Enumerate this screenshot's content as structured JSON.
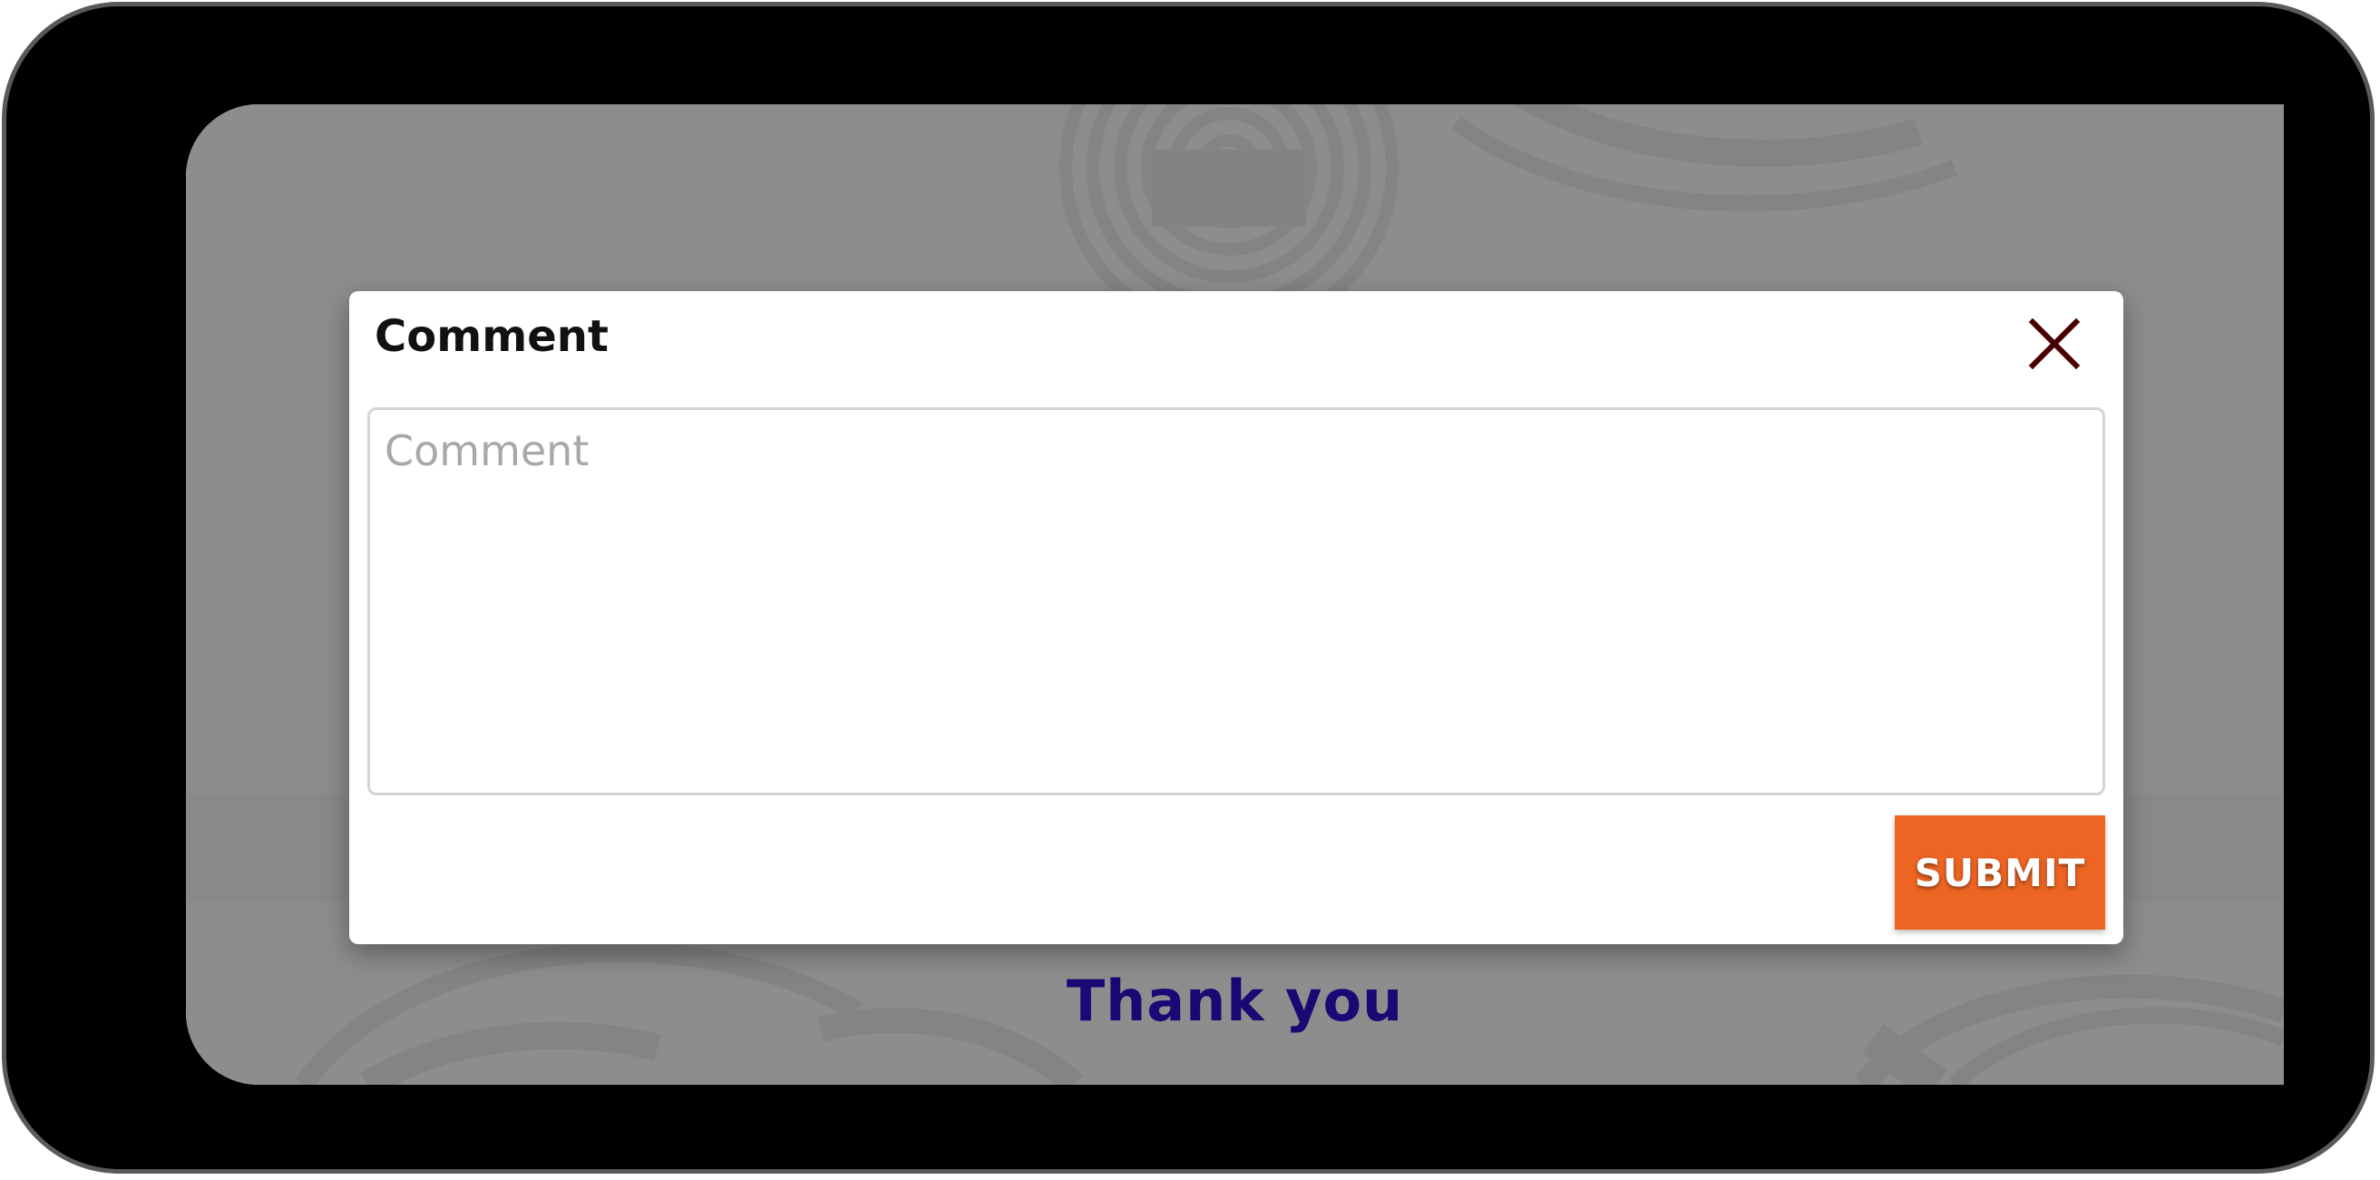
{
  "modal": {
    "title": "Comment",
    "close_icon": "close-icon",
    "comment_input": {
      "value": "",
      "placeholder": "Comment"
    },
    "submit_label": "SUBMIT"
  },
  "page": {
    "thank_you_text": "Thank you"
  },
  "colors": {
    "accent": "#ec6522",
    "thank_you": "#2a10c8",
    "close_icon": "#4a0000",
    "device_frame": "#000000"
  }
}
